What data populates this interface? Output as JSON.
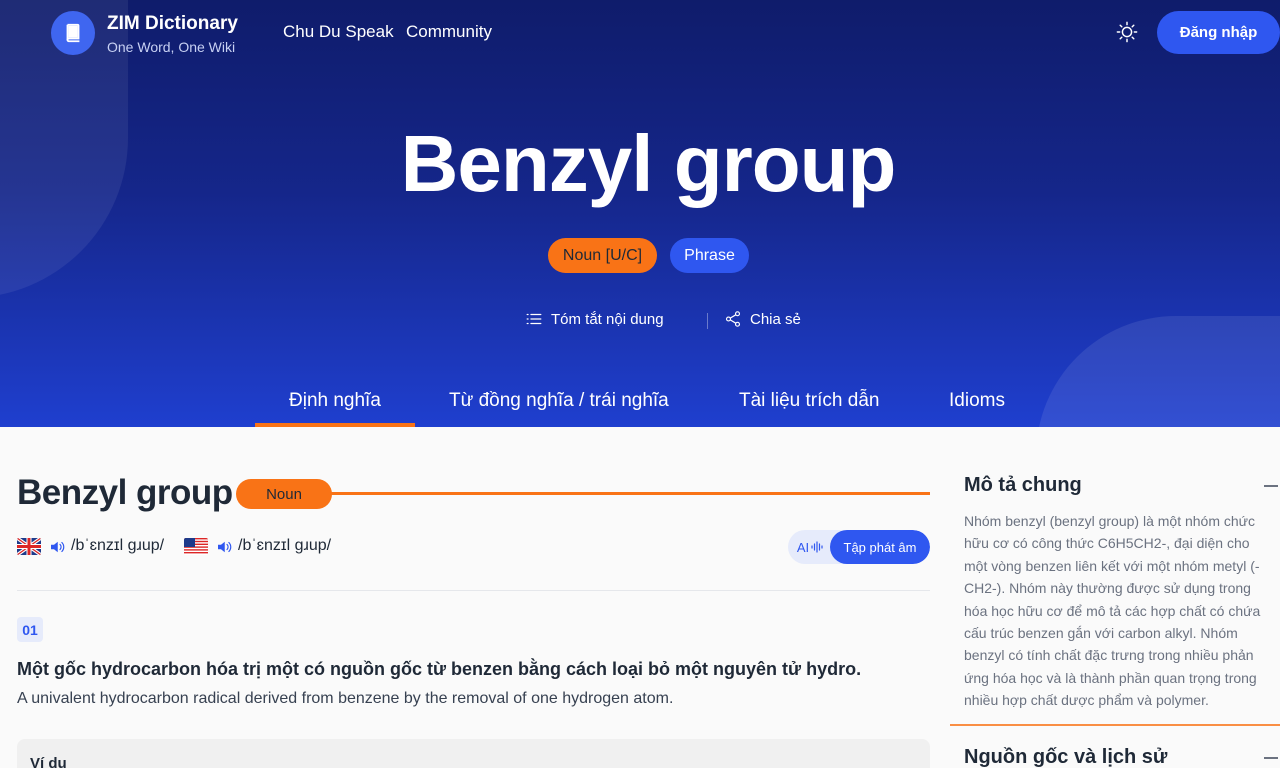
{
  "header": {
    "brand_title": "ZIM Dictionary",
    "brand_subtitle": "One Word, One Wiki",
    "nav": [
      "Chu Du Speak",
      "Community"
    ],
    "login_label": "Đăng nhập"
  },
  "hero": {
    "word": "Benzyl group",
    "tags": [
      "Noun [U/C]",
      "Phrase"
    ],
    "actions": {
      "summary": "Tóm tắt nội dung",
      "share": "Chia sẻ"
    },
    "tabs": [
      "Định nghĩa",
      "Từ đồng nghĩa / trái nghĩa",
      "Tài liệu trích dẫn",
      "Idioms"
    ],
    "active_tab": "Định nghĩa"
  },
  "entry": {
    "word": "Benzyl group",
    "pos": "Noun",
    "pron_uk": "/bˈɛnzɪl gɹup/",
    "pron_us": "/bˈɛnzɪl gɹup/",
    "ai_label": "AI",
    "practice_label": "Tập phát âm",
    "sense_number": "01",
    "definition_vi": "Một gốc hydrocarbon hóa trị một có nguồn gốc từ benzen bằng cách loại bỏ một nguyên tử hydro.",
    "definition_en": "A univalent hydrocarbon radical derived from benzene by the removal of one hydrogen atom.",
    "example_label": "Ví dụ"
  },
  "sidebar": {
    "overview_title": "Mô tả chung",
    "overview_text": "Nhóm benzyl (benzyl group) là một nhóm chức hữu cơ có công thức C6H5CH2-, đại diện cho một vòng benzen liên kết với một nhóm metyl (-CH2-). Nhóm này thường được sử dụng trong hóa học hữu cơ để mô tả các hợp chất có chứa cấu trúc benzen gắn với carbon alkyl. Nhóm benzyl có tính chất đặc trưng trong nhiều phản ứng hóa học và là thành phần quan trọng trong nhiều hợp chất dược phẩm và polymer.",
    "origin_title": "Nguồn gốc và lịch sử"
  },
  "colors": {
    "primary": "#2f57f0",
    "accent": "#f97316",
    "hero_dark": "#0f1c6b"
  },
  "icons": [
    "book-icon",
    "sun-icon",
    "list-icon",
    "share-icon",
    "speaker-icon",
    "uk-flag-icon",
    "us-flag-icon",
    "waveform-icon",
    "minus-icon"
  ]
}
